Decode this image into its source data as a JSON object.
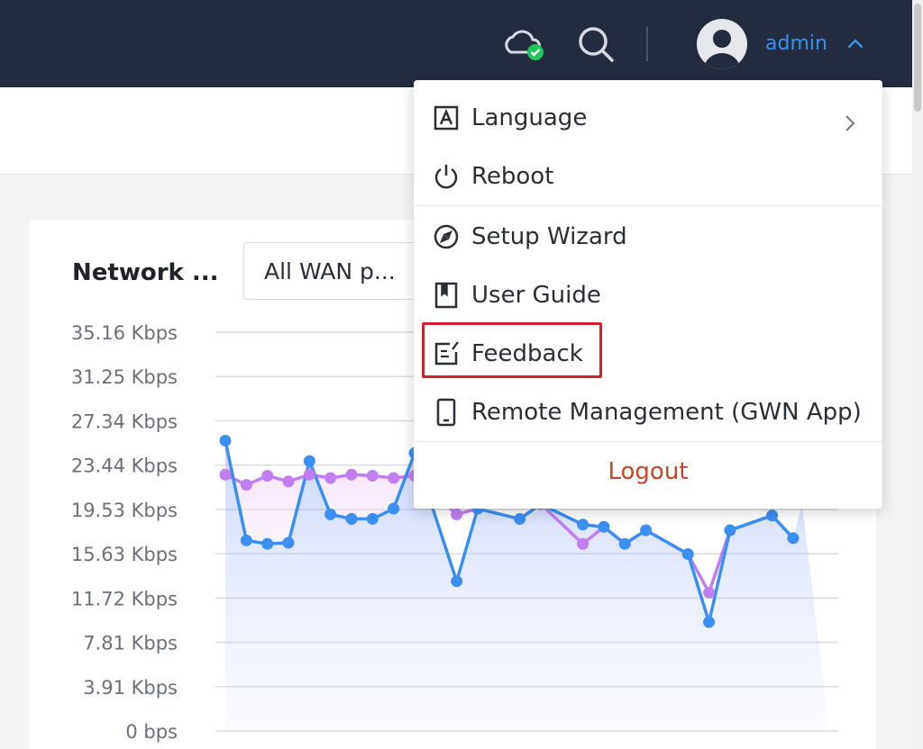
{
  "header": {
    "username": "admin",
    "icons": [
      "cloud-status-icon",
      "search-icon",
      "avatar-icon",
      "chevron-up-icon"
    ],
    "colors": {
      "bar": "#232c3f",
      "accent": "#3b8ff0",
      "status_ok": "#22c55e"
    }
  },
  "card": {
    "title": "Network ...",
    "wan_select": "All WAN p..."
  },
  "menu": {
    "items": [
      {
        "label": "Language",
        "icon": "language-icon",
        "has_submenu": true
      },
      {
        "label": "Reboot",
        "icon": "power-icon"
      },
      {
        "label": "Setup Wizard",
        "icon": "compass-icon"
      },
      {
        "label": "User Guide",
        "icon": "book-icon"
      },
      {
        "label": "Feedback",
        "icon": "feedback-edit-icon",
        "highlighted": true
      },
      {
        "label": "Remote Management (GWN App)",
        "icon": "phone-icon"
      }
    ],
    "logout": "Logout",
    "logout_color": "#c8432a"
  },
  "chart_data": {
    "type": "area",
    "ytick_labels": [
      "35.16 Kbps",
      "31.25 Kbps",
      "27.34 Kbps",
      "23.44 Kbps",
      "19.53 Kbps",
      "15.63 Kbps",
      "11.72 Kbps",
      "7.81 Kbps",
      "3.91 Kbps",
      "0 bps"
    ],
    "ylim": [
      0,
      35.16
    ],
    "grid": true,
    "series": [
      {
        "color": "#3b8ff0",
        "values": [
          25.6,
          16.8,
          16.5,
          16.6,
          23.8,
          19.1,
          18.7,
          18.7,
          19.6,
          24.5,
          null,
          13.2,
          19.6,
          null,
          18.7,
          20.0,
          null,
          18.2,
          18.0,
          16.5,
          17.7,
          null,
          15.6,
          9.6,
          17.7,
          null,
          19.0,
          17.0
        ]
      },
      {
        "color": "#c07ef0",
        "values": [
          22.6,
          21.7,
          22.5,
          22.0,
          22.6,
          22.3,
          22.6,
          22.5,
          22.3,
          22.5,
          null,
          19.1,
          null,
          null,
          null,
          null,
          null,
          16.5,
          null,
          null,
          null,
          null,
          null,
          12.2,
          null,
          null,
          null,
          null
        ]
      }
    ]
  }
}
